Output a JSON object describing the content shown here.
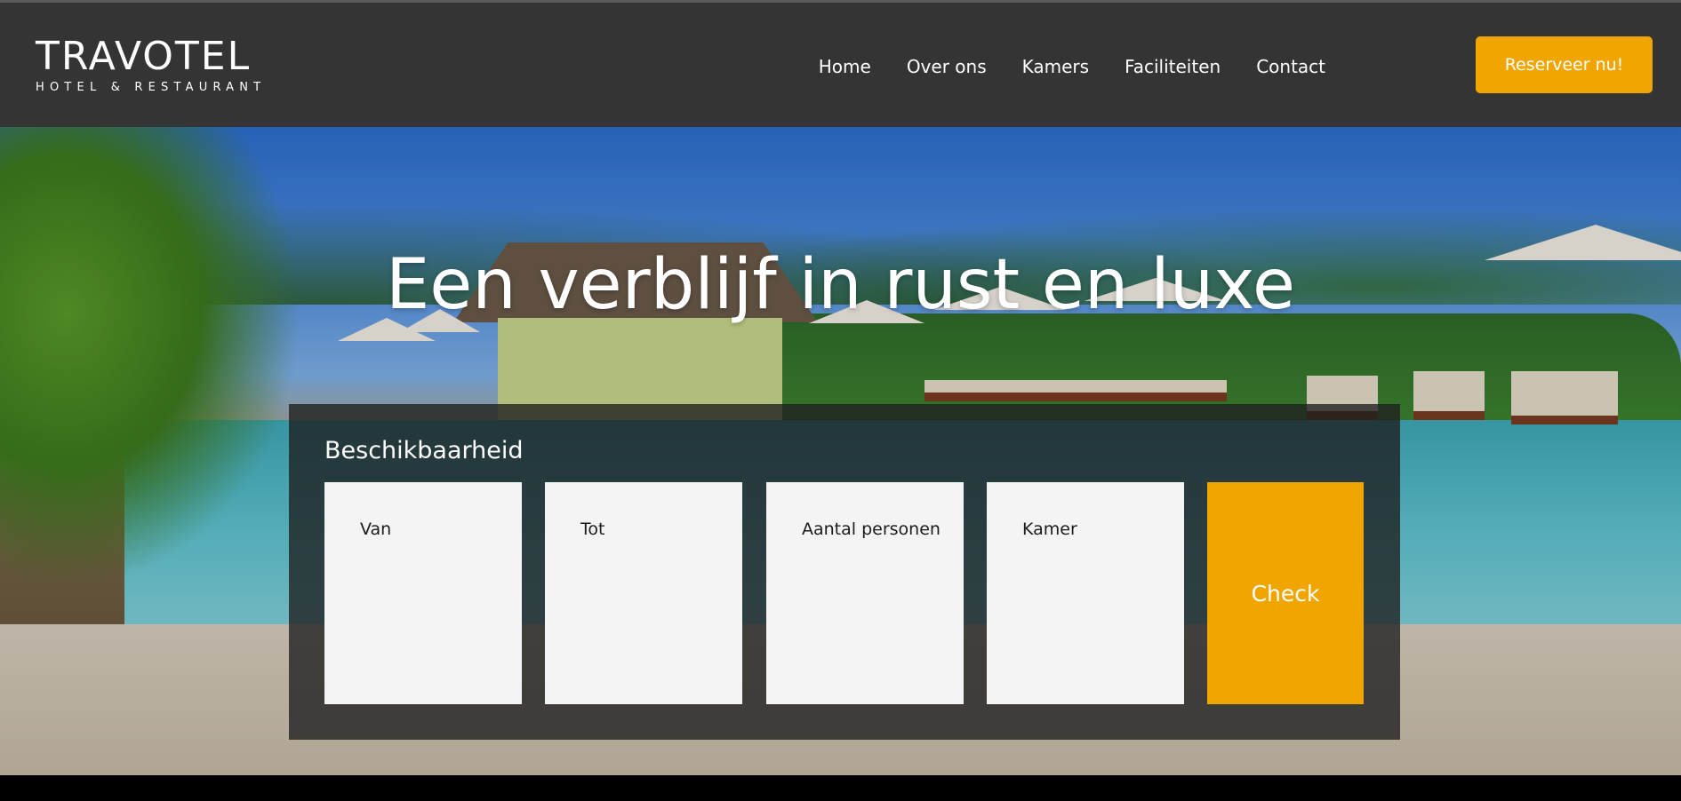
{
  "header": {
    "logo_main": "TRAVOTEL",
    "logo_sub": "HOTEL & RESTAURANT",
    "nav": [
      "Home",
      "Over ons",
      "Kamers",
      "Faciliteiten",
      "Contact"
    ],
    "cta_label": "Reserveer nu!"
  },
  "hero": {
    "title": "Een verblijf in rust en luxe"
  },
  "booking": {
    "title": "Beschikbaarheid",
    "fields": [
      "Van",
      "Tot",
      "Aantal personen",
      "Kamer"
    ],
    "submit_label": "Check"
  },
  "colors": {
    "header_bg": "#343434",
    "accent": "#f0a500",
    "field_bg": "#f4f4f4",
    "panel_bg": "rgba(30,30,30,0.78)"
  }
}
